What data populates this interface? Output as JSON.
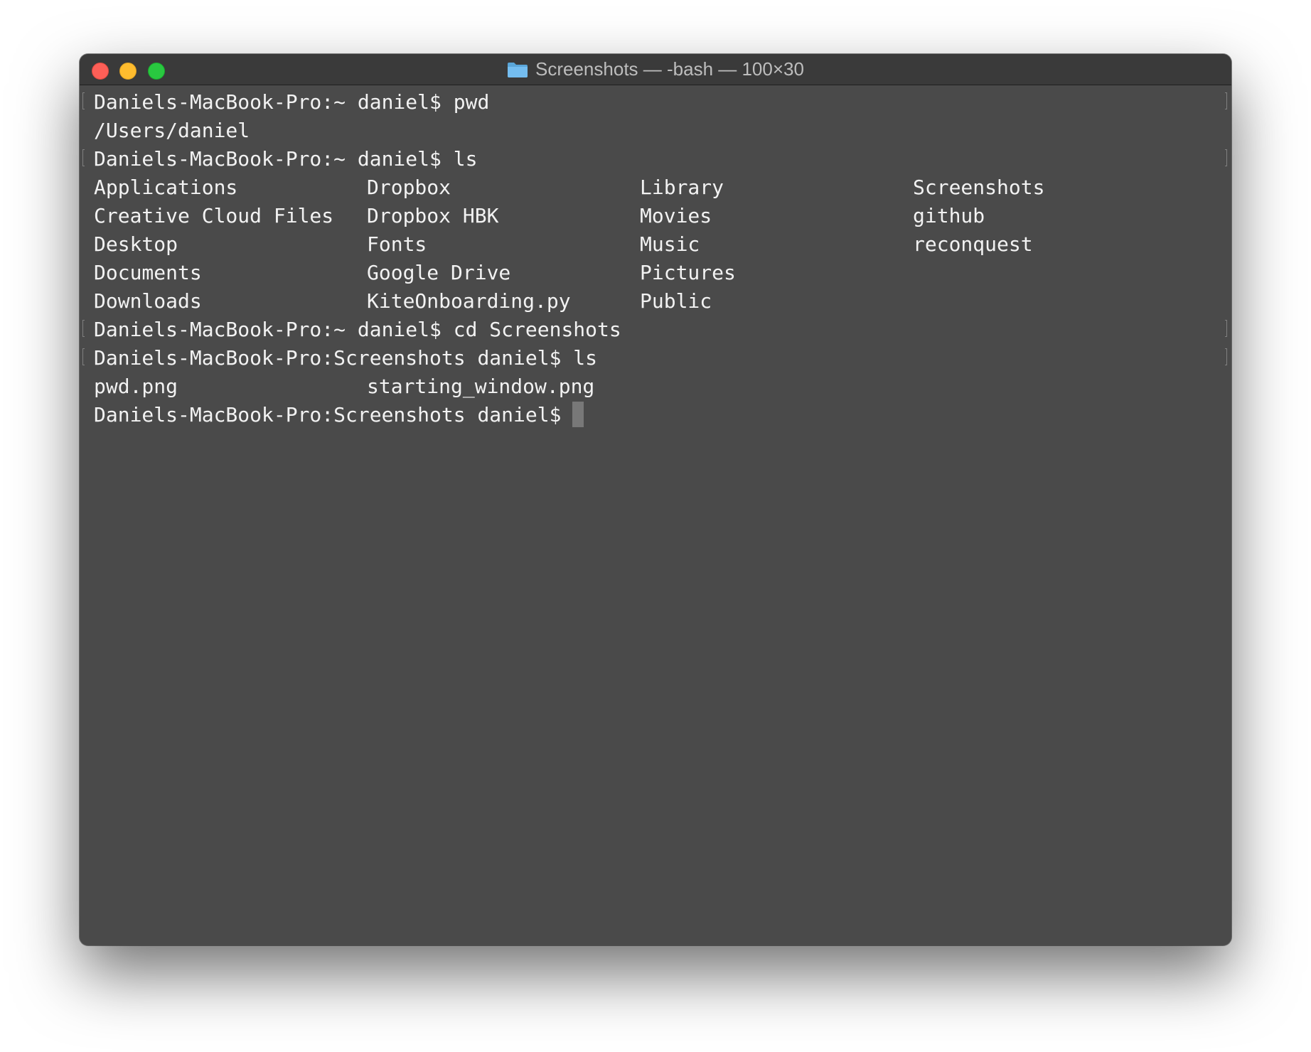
{
  "window": {
    "title": "Screenshots — -bash — 100×30",
    "title_icon": "folder-icon",
    "traffic_lights": {
      "close": "#fd5f57",
      "minimize": "#febc2e",
      "zoom": "#29c840"
    },
    "background_color": "#4a4a4a",
    "text_color": "#f2f2f2"
  },
  "terminal": {
    "cmd1": "Daniels-MacBook-Pro:~ daniel$ pwd",
    "out1": "/Users/daniel",
    "cmd2": "Daniels-MacBook-Pro:~ daniel$ ls",
    "ls_home": [
      [
        "Applications",
        "Dropbox",
        "Library",
        "Screenshots"
      ],
      [
        "Creative Cloud Files",
        "Dropbox HBK",
        "Movies",
        "github"
      ],
      [
        "Desktop",
        "Fonts",
        "Music",
        "reconquest"
      ],
      [
        "Documents",
        "Google Drive",
        "Pictures",
        ""
      ],
      [
        "Downloads",
        "KiteOnboarding.py",
        "Public",
        ""
      ]
    ],
    "cmd3": "Daniels-MacBook-Pro:~ daniel$ cd Screenshots",
    "cmd4": "Daniels-MacBook-Pro:Screenshots daniel$ ls",
    "ls_screenshots": [
      "pwd.png",
      "starting_window.png"
    ],
    "prompt": "Daniels-MacBook-Pro:Screenshots daniel$"
  }
}
